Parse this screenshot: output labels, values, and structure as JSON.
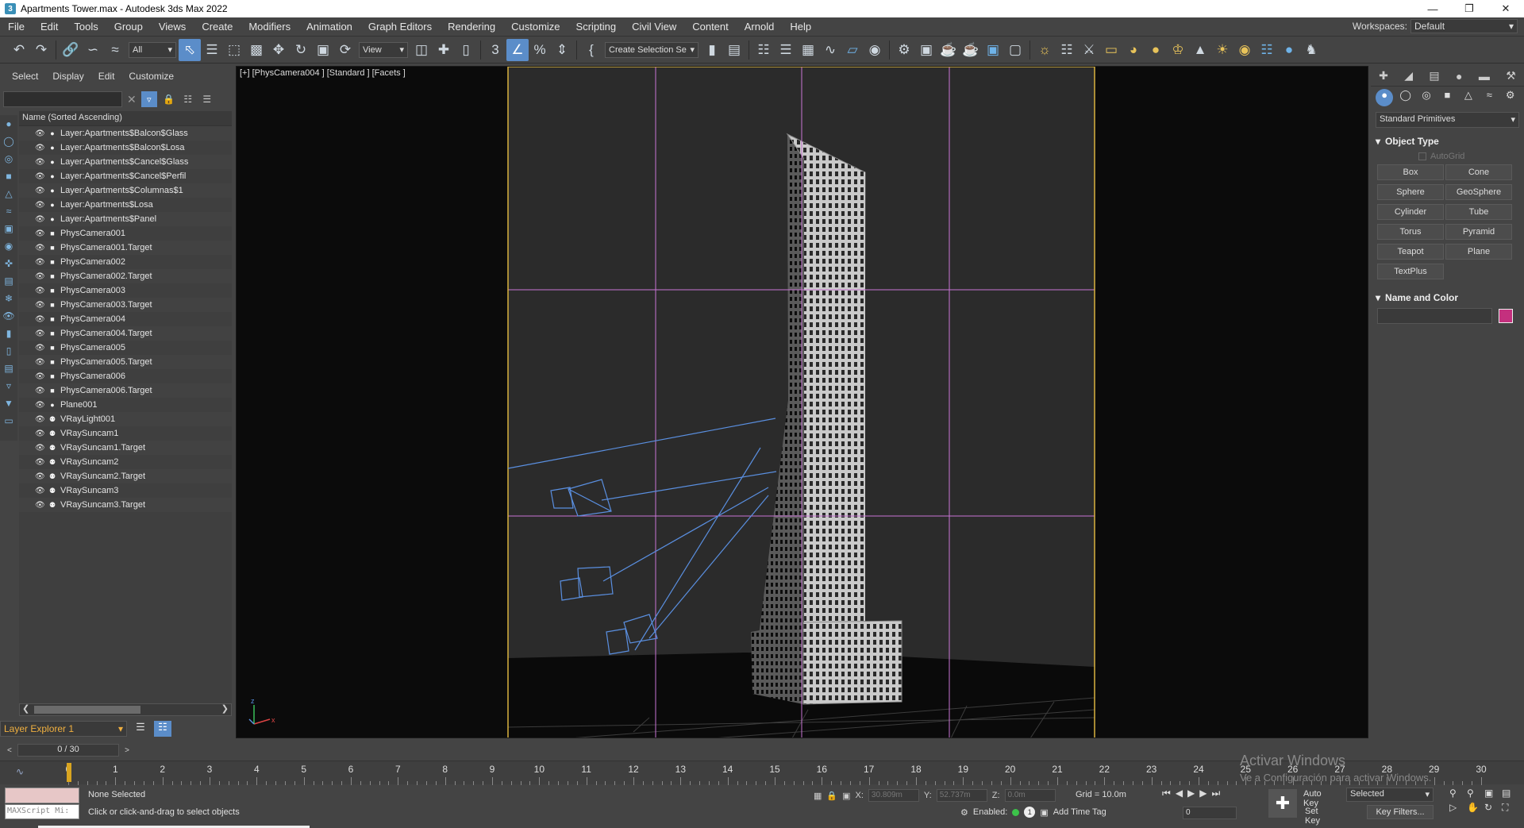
{
  "window": {
    "title": "Apartments Tower.max - Autodesk 3ds Max 2022",
    "app_icon": "3"
  },
  "menu": [
    "File",
    "Edit",
    "Tools",
    "Group",
    "Views",
    "Create",
    "Modifiers",
    "Animation",
    "Graph Editors",
    "Rendering",
    "Customize",
    "Scripting",
    "Civil View",
    "Content",
    "Arnold",
    "Help"
  ],
  "workspaces": {
    "label": "Workspaces:",
    "value": "Default"
  },
  "toolbar": {
    "filter": "All",
    "view": "View",
    "selection_set": "Create Selection Se"
  },
  "explorer": {
    "tabs": [
      "Select",
      "Display",
      "Edit",
      "Customize"
    ],
    "header": "Name (Sorted Ascending)",
    "items": [
      {
        "name": "Layer:Apartments$Balcon$Glass",
        "type": "layer"
      },
      {
        "name": "Layer:Apartments$Balcon$Losa",
        "type": "layer"
      },
      {
        "name": "Layer:Apartments$Cancel$Glass",
        "type": "layer"
      },
      {
        "name": "Layer:Apartments$Cancel$Perfil",
        "type": "layer"
      },
      {
        "name": "Layer:Apartments$Columnas$1",
        "type": "layer"
      },
      {
        "name": "Layer:Apartments$Losa",
        "type": "layer"
      },
      {
        "name": "Layer:Apartments$Panel",
        "type": "layer"
      },
      {
        "name": "PhysCamera001",
        "type": "camera"
      },
      {
        "name": "PhysCamera001.Target",
        "type": "camera"
      },
      {
        "name": "PhysCamera002",
        "type": "camera"
      },
      {
        "name": "PhysCamera002.Target",
        "type": "camera"
      },
      {
        "name": "PhysCamera003",
        "type": "camera"
      },
      {
        "name": "PhysCamera003.Target",
        "type": "camera"
      },
      {
        "name": "PhysCamera004",
        "type": "camera"
      },
      {
        "name": "PhysCamera004.Target",
        "type": "camera"
      },
      {
        "name": "PhysCamera005",
        "type": "camera"
      },
      {
        "name": "PhysCamera005.Target",
        "type": "camera"
      },
      {
        "name": "PhysCamera006",
        "type": "camera"
      },
      {
        "name": "PhysCamera006.Target",
        "type": "camera"
      },
      {
        "name": "Plane001",
        "type": "geometry"
      },
      {
        "name": "VRayLight001",
        "type": "light"
      },
      {
        "name": "VRaySuncam1",
        "type": "light"
      },
      {
        "name": "VRaySuncam1.Target",
        "type": "light"
      },
      {
        "name": "VRaySuncam2",
        "type": "light"
      },
      {
        "name": "VRaySuncam2.Target",
        "type": "light"
      },
      {
        "name": "VRaySuncam3",
        "type": "light"
      },
      {
        "name": "VRaySuncam3.Target",
        "type": "light"
      }
    ],
    "layer_explorer": "Layer Explorer 1"
  },
  "viewport": {
    "label": "[+] [PhysCamera004 ] [Standard ] [Facets ]",
    "axis_x": "x",
    "axis_z": "z"
  },
  "command_panel": {
    "category": "Standard Primitives",
    "object_type_title": "Object Type",
    "autogrid": "AutoGrid",
    "buttons": [
      "Box",
      "Cone",
      "Sphere",
      "GeoSphere",
      "Cylinder",
      "Tube",
      "Torus",
      "Pyramid",
      "Teapot",
      "Plane",
      "TextPlus"
    ],
    "name_color_title": "Name and Color",
    "color": "#c4307e"
  },
  "time": {
    "slider": "0 / 30",
    "ticks": [
      "0",
      "1",
      "2",
      "3",
      "4",
      "5",
      "6",
      "7",
      "8",
      "9",
      "10",
      "11",
      "12",
      "13",
      "14",
      "15",
      "16",
      "17",
      "18",
      "19",
      "20",
      "21",
      "22",
      "23",
      "24",
      "25",
      "26",
      "27",
      "28",
      "29",
      "30"
    ]
  },
  "status": {
    "maxscript": "MAXScript Mi:",
    "selection": "None Selected",
    "hint": "Click or click-and-drag to select objects",
    "x_label": "X:",
    "x": "30.809m",
    "y_label": "Y:",
    "y": "52.737m",
    "z_label": "Z:",
    "z": "0.0m",
    "grid": "Grid = 10.0m",
    "enabled": "Enabled:",
    "enabled_num": "1",
    "add_time_tag": "Add Time Tag",
    "frame": "0",
    "auto_key": "Auto Key",
    "set_key": "Set Key",
    "selected": "Selected",
    "key_filters": "Key Filters..."
  },
  "watermark": {
    "line1": "Activar Windows",
    "line2": "Ve a Configuración para activar Windows."
  }
}
